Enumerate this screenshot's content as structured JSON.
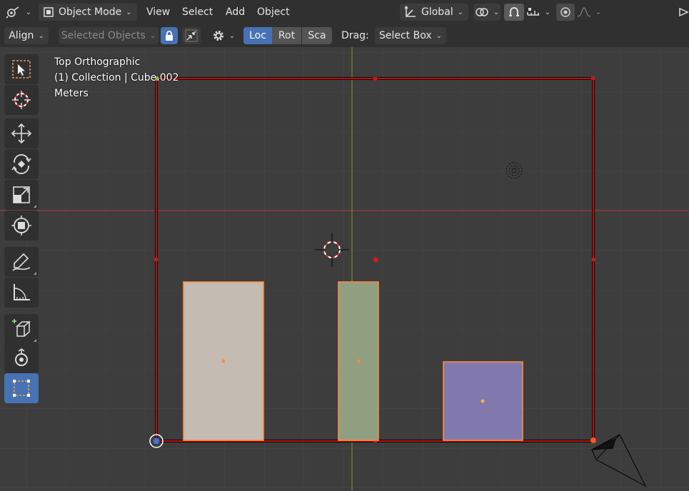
{
  "header": {
    "mode": "Object Mode",
    "menus": [
      "View",
      "Select",
      "Add",
      "Object"
    ],
    "orientation": "Global"
  },
  "toolsettings": {
    "align": "Align",
    "selected_objects": "Selected Objects",
    "loc": "Loc",
    "rot": "Rot",
    "sca": "Sca",
    "drag_label": "Drag:",
    "drag_value": "Select Box"
  },
  "viewport": {
    "view_name": "Top Orthographic",
    "collection": "(1) Collection | Cube.002",
    "units": "Meters"
  },
  "colors": {
    "accent": "#4772b3",
    "selection_outline": "#ff8a3d",
    "active_outline": "#c01c1c",
    "x_axis": "#a33a3a",
    "y_axis": "#6f8f2a",
    "cube_left": "#c4bbb2",
    "cube_middle": "#8f9f80",
    "cube_right": "#8179ad"
  },
  "icons": {
    "editor_type": "editor-type-icon",
    "object_mode": "object-mode-icon",
    "transform_orientation": "transform-orientation-icon",
    "pivot": "pivot-icon",
    "snap": "snap-icon",
    "snap_increment": "snap-increment-icon",
    "proportional": "proportional-edit-icon",
    "falloff": "falloff-icon",
    "lock": "lock-icon",
    "affect_parents": "affect-only-parents-icon",
    "options": "gear-icon"
  }
}
